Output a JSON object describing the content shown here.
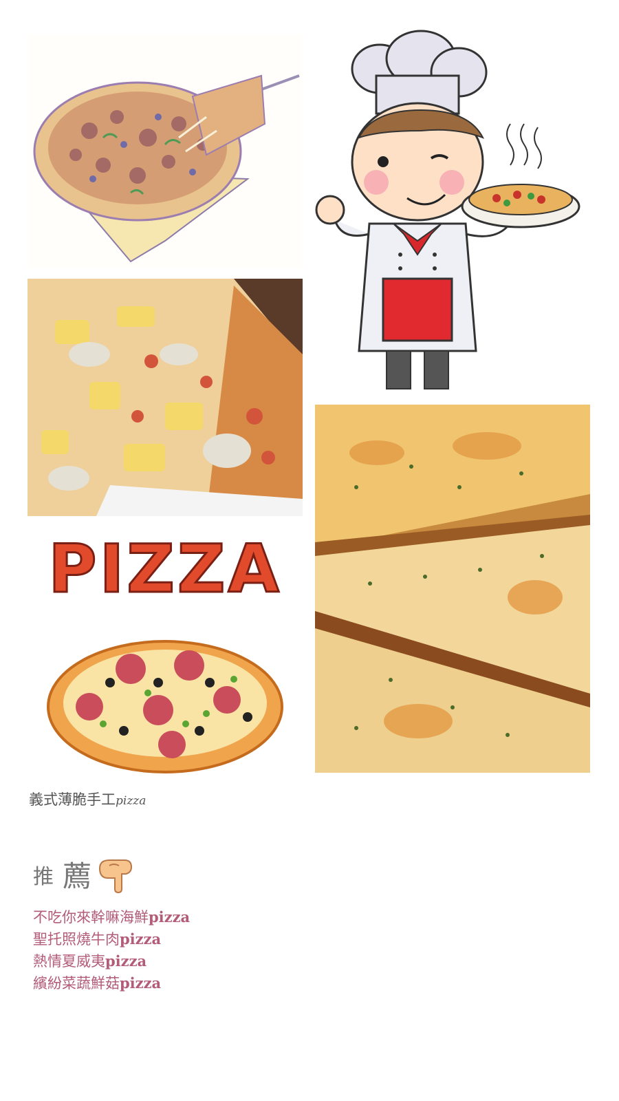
{
  "images": [
    {
      "id": "sketch",
      "icon": "pizza-sketch-illustration"
    },
    {
      "id": "chef",
      "icon": "chef-with-pizza-illustration"
    },
    {
      "id": "photo1",
      "icon": "hawaiian-pizza-photo"
    },
    {
      "id": "photo2",
      "icon": "cheese-pizza-closeup-photo"
    },
    {
      "id": "cartoon",
      "icon": "pizza-word-and-cartoon-pizza"
    }
  ],
  "cartoon_word": "PIZZA",
  "caption": {
    "chinese": "義式薄脆手工",
    "latin": "pizza"
  },
  "recommend": {
    "label_small": "推",
    "label_big": "薦",
    "hand_icon": "pointing-hand-icon"
  },
  "items": [
    {
      "chinese": "不吃你來幹嘛海鮮",
      "latin": "pizza"
    },
    {
      "chinese": "聖托照燒牛肉",
      "latin": "pizza"
    },
    {
      "chinese": "熱情夏威夷",
      "latin": "pizza"
    },
    {
      "chinese": "繽紛菜蔬鮮菇",
      "latin": "pizza"
    }
  ],
  "colors": {
    "accent": "#b35c78",
    "text": "#555555",
    "heading": "#777777"
  }
}
